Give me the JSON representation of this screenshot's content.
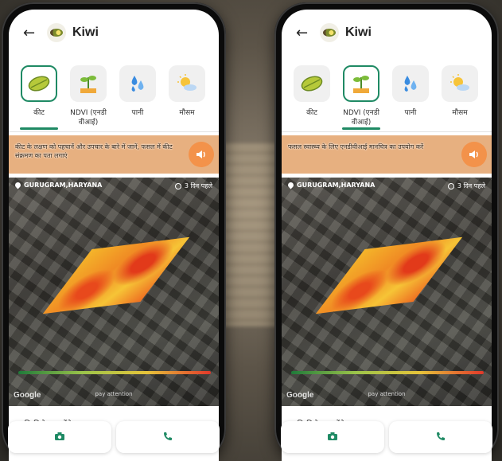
{
  "screens": [
    {
      "header": {
        "title": "Kiwi"
      },
      "tabs": [
        {
          "label": "कीट",
          "icon": "leaf-pest-icon",
          "active": true
        },
        {
          "label": "NDVI (एनडी वीआई)",
          "icon": "plant-ndvi-icon",
          "active": false
        },
        {
          "label": "पानी",
          "icon": "water-drops-icon",
          "active": false
        },
        {
          "label": "मौसम",
          "icon": "weather-icon",
          "active": false
        }
      ],
      "banner": {
        "text": "कीट के लक्षण को पहचानें और उपचार के बारे में जानें, फसल में कीट संक्रमण का पता लगाएं"
      },
      "map": {
        "location": "GURUGRAM,HARYANA",
        "time_ago": "3 दिन पहले",
        "pay_attention": "pay attention",
        "google": "Google"
      },
      "expert": "कृषि विशेषज्ञ करेंगे समाधान"
    },
    {
      "header": {
        "title": "Kiwi"
      },
      "tabs": [
        {
          "label": "कीट",
          "icon": "leaf-pest-icon",
          "active": false
        },
        {
          "label": "NDVI (एनडी वीआई)",
          "icon": "plant-ndvi-icon",
          "active": true
        },
        {
          "label": "पानी",
          "icon": "water-drops-icon",
          "active": false
        },
        {
          "label": "मौसम",
          "icon": "weather-icon",
          "active": false
        }
      ],
      "banner": {
        "text": "फसल स्वास्थ्य के लिए एनडीवीआई मानचित्र का उपयोग करें"
      },
      "map": {
        "location": "GURUGRAM,HARYANA",
        "time_ago": "3 दिन पहले",
        "pay_attention": "pay attention",
        "google": "Google"
      },
      "expert": "कृषि विशेषज्ञ करेंगे समाधान"
    }
  ],
  "colors": {
    "accent": "#1f8a64",
    "speaker": "#f3924a",
    "banner": "#e7b080"
  }
}
